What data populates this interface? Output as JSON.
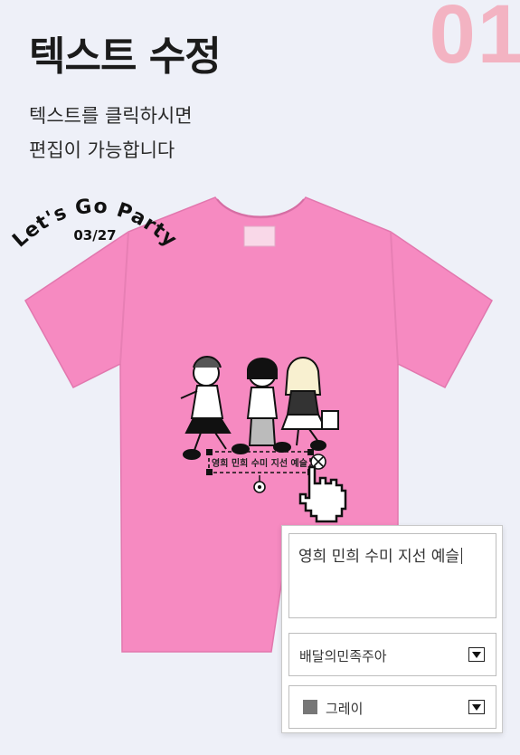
{
  "step_number": "01",
  "title": "텍스트 수정",
  "description": [
    "텍스트를 클릭하시면",
    "편집이 가능합니다"
  ],
  "colors": {
    "shirt": "#f68ac1",
    "step_number": "#f3b3c2",
    "background": "#eef0f8"
  },
  "design": {
    "headline": "Let's Go Party",
    "date": "03/27",
    "editable_line": "영희 민희 수미 지선 예슬"
  },
  "editor": {
    "text_value": "영희 민희 수미 지선 예슬",
    "font_select": "배달의민족주아",
    "color_select": "그레이",
    "color_swatch": "#777777"
  }
}
